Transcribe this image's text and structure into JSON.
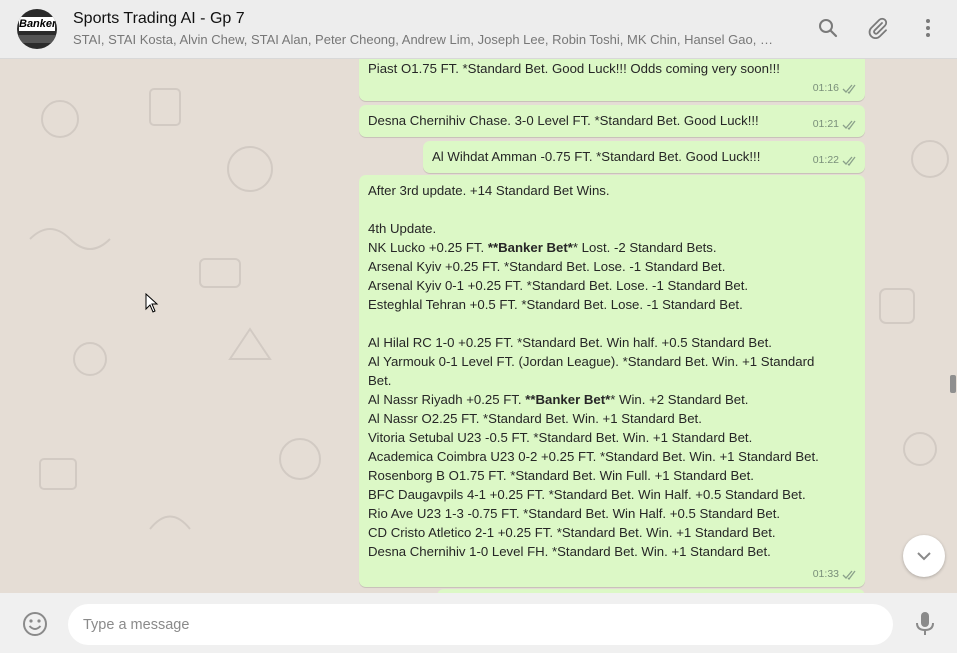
{
  "header": {
    "title": "Sports Trading AI - Gp 7",
    "members": "STAI, STAI Kosta, Alvin Chew, STAI Alan, Peter Cheong, Andrew Lim, Joseph Lee, Robin Toshi, MK Chin, Hansel Gao, Dickso...",
    "avatar_text": "Banker",
    "icons": [
      "search-icon",
      "attach-icon",
      "menu-icon"
    ]
  },
  "messages": [
    {
      "lines": [
        "Piast O1.75 FT. *Standard Bet. Good Luck!!! Odds coming very soon!!!"
      ],
      "time": "01:16"
    },
    {
      "lines": [
        "Desna Chernihiv Chase. 3-0 Level FT. *Standard Bet. Good Luck!!!"
      ],
      "time": "01:21"
    },
    {
      "lines": [
        "Al Wihdat Amman -0.75 FT. *Standard Bet. Good Luck!!!"
      ],
      "time": "01:22"
    },
    {
      "time": "01:33",
      "intro": "After 3rd update. +14 Standard Bet Wins.",
      "heading": "4th Update.",
      "nk_pre": "NK Lucko +0.25 FT. ",
      "banker_label": "**Banker Bet*",
      "nk_post": "* Lost. -2 Standard Bets.",
      "group1": [
        "Arsenal Kyiv +0.25 FT. *Standard Bet. Lose. -1 Standard Bet.",
        "Arsenal Kyiv 0-1 +0.25 FT. *Standard Bet. Lose. -1 Standard Bet.",
        "Esteghlal Tehran +0.5 FT. *Standard Bet. Lose. -1 Standard Bet."
      ],
      "alhilal": "Al Hilal RC 1-0 +0.25 FT. *Standard Bet. Win half. +0.5 Standard Bet.",
      "alyarmouk_1": "Al Yarmouk 0-1 Level FT. (Jordan League). *Standard Bet. Win. +1 Standard",
      "alyarmouk_2": "Bet.",
      "alnassr_pre": "Al Nassr Riyadh +0.25 FT. ",
      "alnassr_post": "* Win. +2 Standard Bet.",
      "group2": [
        "Al Nassr O2.25 FT. *Standard Bet. Win. +1 Standard Bet.",
        "Vitoria Setubal U23 -0.5 FT. *Standard Bet. Win. +1 Standard Bet.",
        "Academica Coimbra U23 0-2 +0.25 FT. *Standard Bet. Win. +1 Standard Bet.",
        "Rosenborg B O1.75 FT. *Standard Bet. Win Full. +1 Standard Bet.",
        "BFC Daugavpils 4-1 +0.25 FT. *Standard Bet. Win Half. +0.5 Standard Bet.",
        "Rio Ave U23 1-3 -0.75 FT. *Standard Bet. Win Half. +0.5 Standard Bet.",
        "CD Cristo Atletico 2-1 +0.25 FT. *Standard Bet. Win. +1 Standard Bet.",
        "Desna Chernihiv 1-0 Level FH. *Standard Bet. Win. +1 Standard Bet."
      ]
    }
  ],
  "composer": {
    "placeholder": "Type a message"
  },
  "colors": {
    "outgoing_bubble": "#dcf8c6",
    "chat_bg": "#e5ddd5",
    "header_bg": "#ededed"
  }
}
